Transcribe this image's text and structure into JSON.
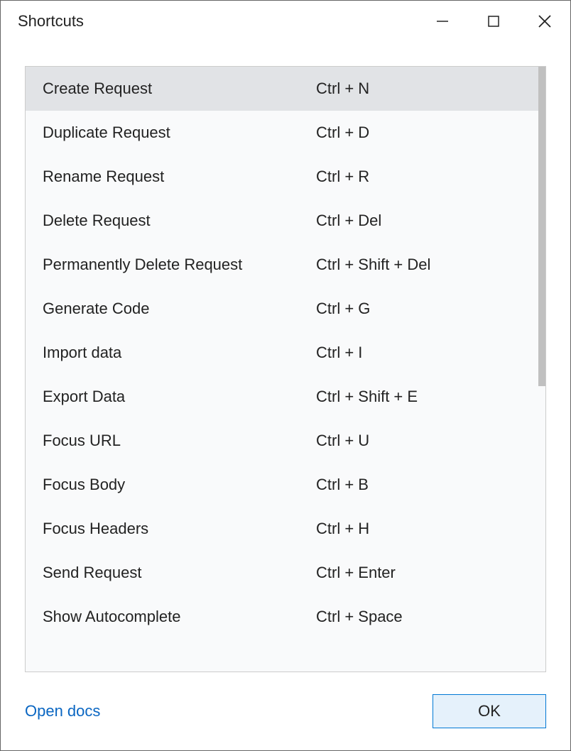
{
  "window": {
    "title": "Shortcuts"
  },
  "shortcuts": [
    {
      "action": "Create Request",
      "keys": "Ctrl + N",
      "selected": true
    },
    {
      "action": "Duplicate Request",
      "keys": "Ctrl + D",
      "selected": false
    },
    {
      "action": "Rename Request",
      "keys": "Ctrl + R",
      "selected": false
    },
    {
      "action": "Delete Request",
      "keys": "Ctrl + Del",
      "selected": false
    },
    {
      "action": "Permanently Delete Request",
      "keys": "Ctrl + Shift + Del",
      "selected": false
    },
    {
      "action": "Generate Code",
      "keys": "Ctrl + G",
      "selected": false
    },
    {
      "action": "Import data",
      "keys": "Ctrl + I",
      "selected": false
    },
    {
      "action": "Export Data",
      "keys": "Ctrl + Shift + E",
      "selected": false
    },
    {
      "action": "Focus URL",
      "keys": "Ctrl + U",
      "selected": false
    },
    {
      "action": "Focus Body",
      "keys": "Ctrl + B",
      "selected": false
    },
    {
      "action": "Focus Headers",
      "keys": "Ctrl + H",
      "selected": false
    },
    {
      "action": "Send Request",
      "keys": "Ctrl + Enter",
      "selected": false
    },
    {
      "action": "Show Autocomplete",
      "keys": "Ctrl + Space",
      "selected": false
    }
  ],
  "footer": {
    "open_docs": "Open docs",
    "ok": "OK"
  }
}
